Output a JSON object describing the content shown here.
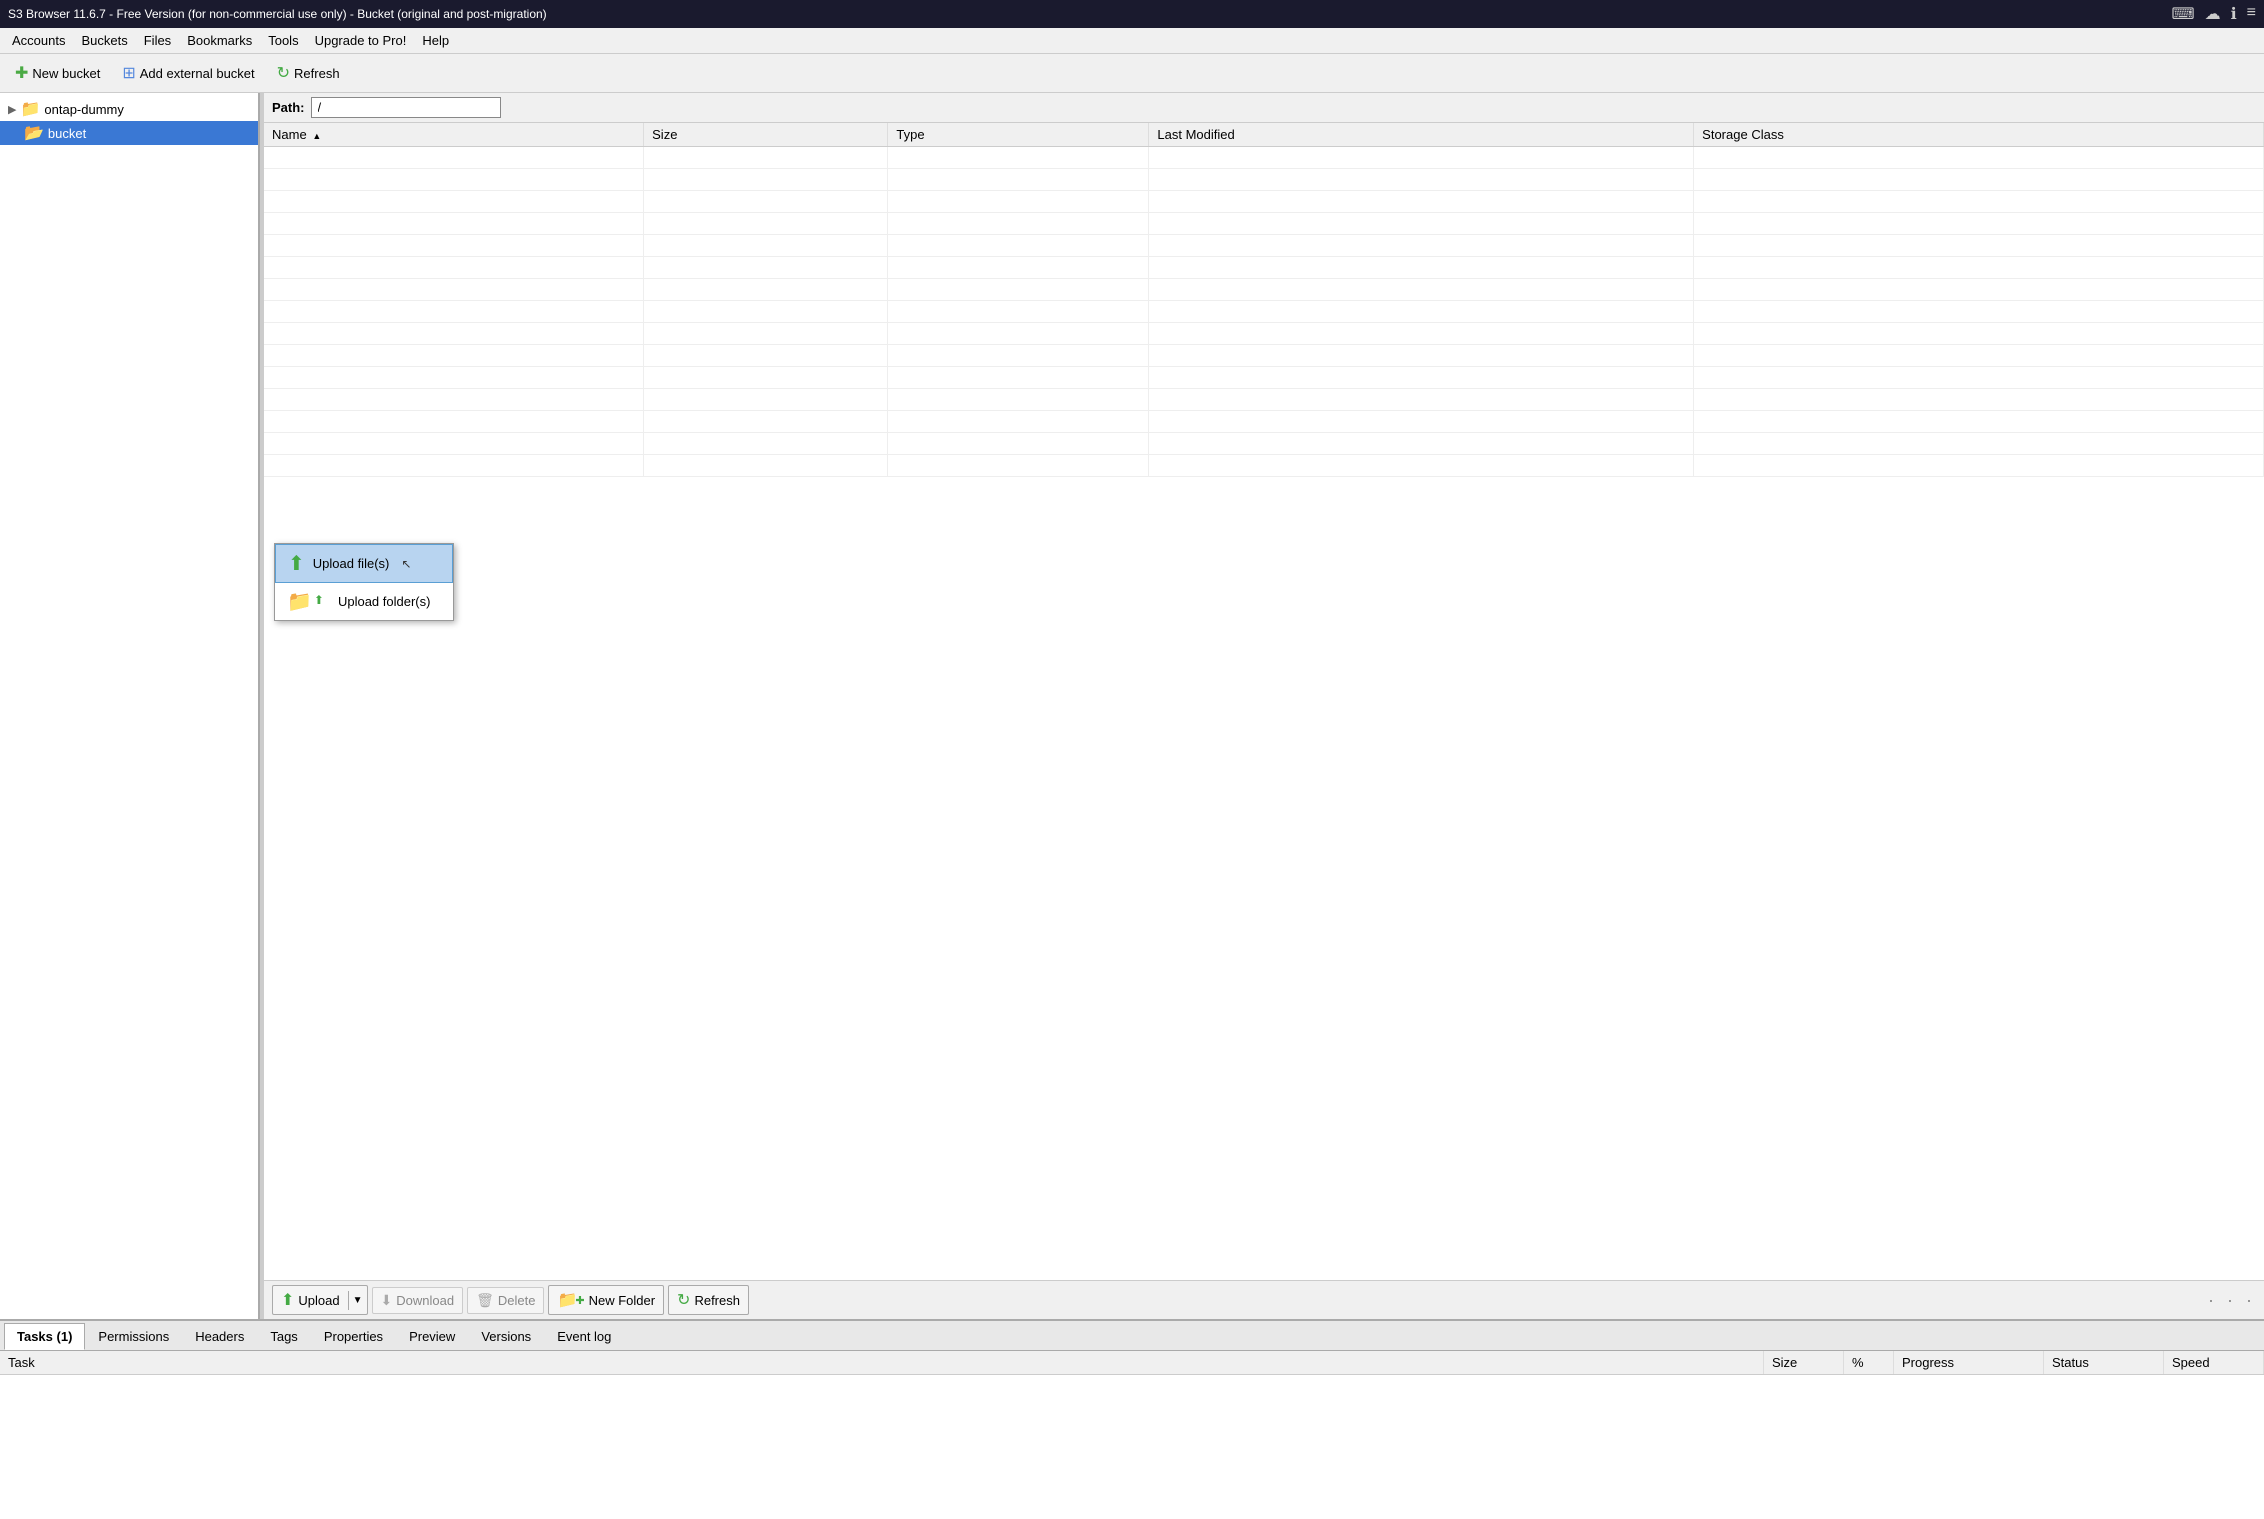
{
  "titlebar": {
    "title": "S3 Browser 11.6.7 - Free Version (for non-commercial use only) - Bucket (original and post-migration)",
    "icons": [
      "keyboard-icon",
      "cloud-icon",
      "info-icon",
      "list-icon"
    ]
  },
  "menubar": {
    "items": [
      "Accounts",
      "Buckets",
      "Files",
      "Bookmarks",
      "Tools",
      "Upgrade to Pro!",
      "Help"
    ]
  },
  "toolbar": {
    "new_bucket_label": "New bucket",
    "add_external_label": "Add external bucket",
    "refresh_label": "Refresh"
  },
  "path_bar": {
    "label": "Path:",
    "value": "/"
  },
  "file_table": {
    "columns": [
      "Name",
      "Size",
      "Type",
      "Last Modified",
      "Storage Class"
    ],
    "rows": []
  },
  "upload_dropdown": {
    "items": [
      {
        "label": "Upload file(s)",
        "icon": "upload-file-icon",
        "active": true
      },
      {
        "label": "Upload folder(s)",
        "icon": "upload-folder-icon",
        "active": false
      }
    ]
  },
  "bottom_toolbar": {
    "upload_label": "Upload",
    "download_label": "Download",
    "delete_label": "Delete",
    "new_folder_label": "New Folder",
    "refresh_label": "Refresh"
  },
  "tree": {
    "items": [
      {
        "label": "ontap-dummy",
        "level": 0,
        "type": "root",
        "selected": false
      },
      {
        "label": "bucket",
        "level": 1,
        "type": "bucket",
        "selected": true
      }
    ]
  },
  "tabs": {
    "items": [
      "Tasks (1)",
      "Permissions",
      "Headers",
      "Tags",
      "Properties",
      "Preview",
      "Versions",
      "Event log"
    ],
    "active": 0
  },
  "tasks_table": {
    "columns": [
      "Task",
      "Size",
      "%",
      "Progress",
      "Status",
      "Speed"
    ],
    "rows": []
  },
  "dots": "· · ·"
}
